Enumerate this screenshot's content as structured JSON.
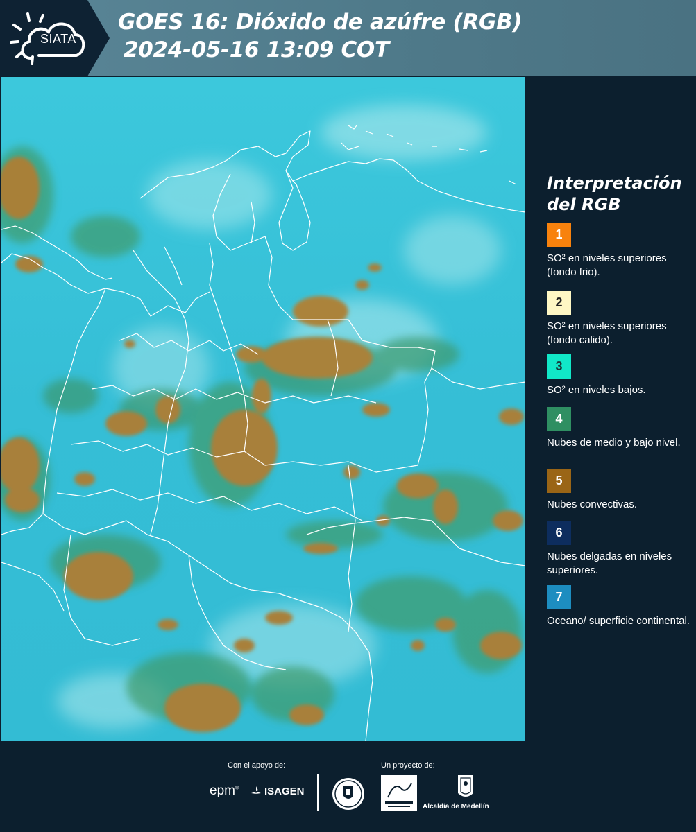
{
  "header": {
    "logo_text": "SIATA",
    "title_line1": "GOES 16: Dióxido de azúfre (RGB)",
    "title_line2": "2024-05-16 13:09 COT"
  },
  "map": {
    "ocean_color": "#38c4da",
    "cloud_color": "#a9823e",
    "border_color": "#ffffff"
  },
  "legend": {
    "title": "Interpretación\ndel RGB",
    "items": [
      {
        "number": "1",
        "color": "#f8820d",
        "text_color": "#ffffff",
        "description": "SO² en niveles superiores (fondo frio)."
      },
      {
        "number": "2",
        "color": "#fef7c4",
        "text_color": "#222222",
        "description": "SO² en niveles superiores (fondo calido)."
      },
      {
        "number": "3",
        "color": "#11e8c8",
        "text_color": "#1a3a3a",
        "description": "SO² en niveles bajos."
      },
      {
        "number": "4",
        "color": "#2f8f62",
        "text_color": "#ffffff",
        "description": "Nubes de medio y bajo nivel."
      },
      {
        "number": "5",
        "color": "#9a6516",
        "text_color": "#ffffff",
        "description": "Nubes convectivas."
      },
      {
        "number": "6",
        "color": "#0d2d5e",
        "text_color": "#ffffff",
        "description": "Nubes delgadas en niveles superiores."
      },
      {
        "number": "7",
        "color": "#1d8dc0",
        "text_color": "#ffffff",
        "description": "Oceano/ superficie continental."
      }
    ]
  },
  "footer": {
    "support_label": "Con el apoyo de:",
    "project_label": "Un proyecto de:",
    "sponsor_1": "epm",
    "sponsor_2": "ISAGEN",
    "partner_3": "Alcaldía de Medellín"
  }
}
